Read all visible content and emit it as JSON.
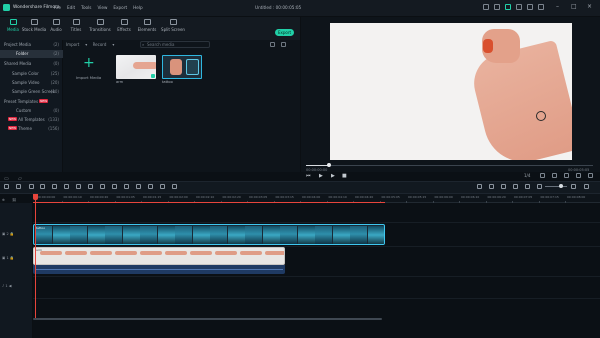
{
  "app": {
    "name": "Wondershare Filmora",
    "document_title": "Untitled : 00:00:05:05",
    "menu": [
      "File",
      "Edit",
      "Tools",
      "View",
      "Export",
      "Help"
    ],
    "export_label": "Export"
  },
  "toolbar": {
    "tabs": [
      {
        "label": "Media"
      },
      {
        "label": "Stock Media"
      },
      {
        "label": "Audio"
      },
      {
        "label": "Titles"
      },
      {
        "label": "Transitions"
      },
      {
        "label": "Effects"
      },
      {
        "label": "Elements"
      },
      {
        "label": "Split Screen"
      }
    ],
    "active_tab": "Media"
  },
  "sidebar": {
    "items": [
      {
        "label": "Project Media",
        "count": "(2)"
      },
      {
        "label": "Folder",
        "count": "(2)"
      },
      {
        "label": "Shared Media",
        "count": "(0)"
      },
      {
        "label": "Sample Color",
        "count": "(25)"
      },
      {
        "label": "Sample Video",
        "count": "(20)"
      },
      {
        "label": "Sample Green Screen",
        "count": "(10)"
      },
      {
        "label": "Preset Templates",
        "badge": "NEW",
        "count": ""
      },
      {
        "label": "Custom",
        "count": "(0)"
      },
      {
        "label": "All Templates",
        "badge": "NEW",
        "count": "(133)"
      },
      {
        "label": "Theme",
        "badge": "NEW",
        "count": "(156)"
      }
    ],
    "selected": "Folder"
  },
  "media_bin": {
    "import_dropdown": "Import",
    "record_dropdown": "Record",
    "search_placeholder": "Search media",
    "import_tile_label": "Import Media",
    "clips": [
      {
        "label": "arm"
      },
      {
        "label": "tattoo"
      }
    ]
  },
  "preview": {
    "time_start": "00:00:00:00",
    "time_end": "00:00:05:05",
    "quality": "1/4",
    "progress": 0.08
  },
  "timeline": {
    "ruler_labels": [
      "00:00:00:00",
      "00:00:00:10",
      "00:00:00:20",
      "00:00:01:05",
      "00:00:01:15",
      "00:00:02:00",
      "00:00:02:10",
      "00:00:02:20",
      "00:00:03:05",
      "00:00:03:15",
      "00:00:04:00",
      "00:00:04:10",
      "00:00:04:20",
      "00:00:05:05",
      "00:00:05:15",
      "00:00:06:00",
      "00:00:06:10",
      "00:00:06:20",
      "00:00:07:05",
      "00:00:07:15",
      "00:00:08:00"
    ],
    "video_clip_label": "tattoo",
    "photo_clip_label": "arm",
    "track_labels": [
      "2",
      "1",
      "1"
    ]
  },
  "colors": {
    "accent": "#21d0a8",
    "playhead": "#e8453c",
    "selected_clip_border": "#3fc7ef"
  }
}
